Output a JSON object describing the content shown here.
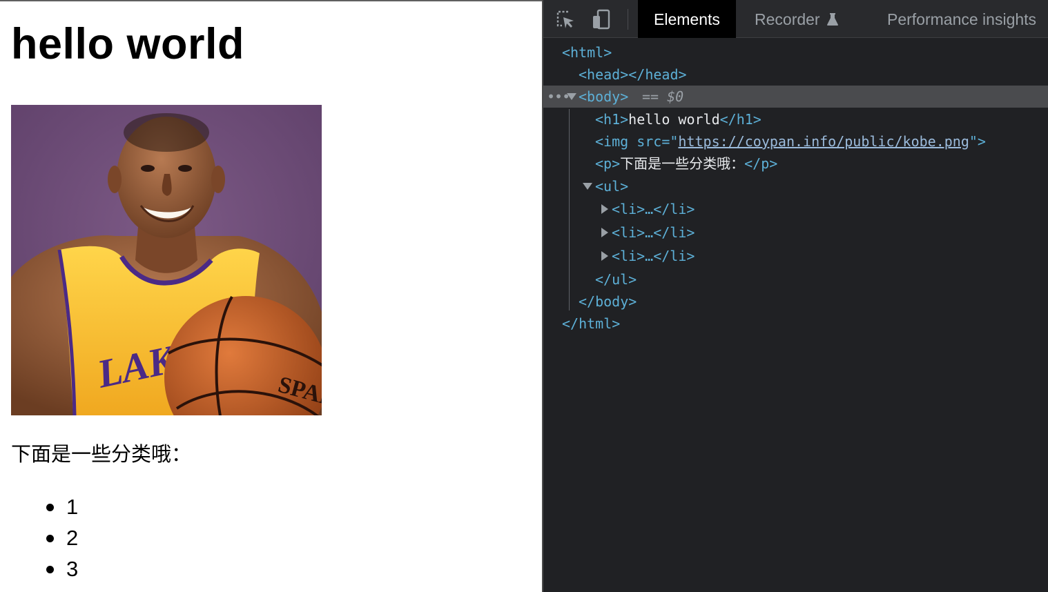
{
  "page": {
    "heading": "hello world",
    "image_alt": "Kobe Bryant in a Lakers jersey holding a basketball",
    "paragraph": "下面是一些分类哦：",
    "list_items": [
      "1",
      "2",
      "3"
    ]
  },
  "devtools": {
    "tabs": [
      "Elements",
      "Recorder",
      "Performance insights"
    ],
    "active_tab": "Elements",
    "tree": {
      "html_open": "<html>",
      "head": "<head></head>",
      "body_open": "<body>",
      "selected_marker": "== $0",
      "h1_open": "<h1>",
      "h1_text": "hello world",
      "h1_close": "</h1>",
      "img_open": "<img src=\"",
      "img_src": "https://coypan.info/public/kobe.png",
      "img_close": "\">",
      "p_open": "<p>",
      "p_text": "下面是一些分类哦：",
      "p_close": "</p>",
      "ul_open": "<ul>",
      "li_collapsed": "<li>…</li>",
      "ul_close": "</ul>",
      "body_close": "</body>",
      "html_close": "</html>"
    },
    "colors": {
      "background": "#202124",
      "toolbar": "#292a2d",
      "tag": "#5db0d7",
      "attribute": "#9bbbdc",
      "selected_row": "#4a4b4e"
    }
  }
}
